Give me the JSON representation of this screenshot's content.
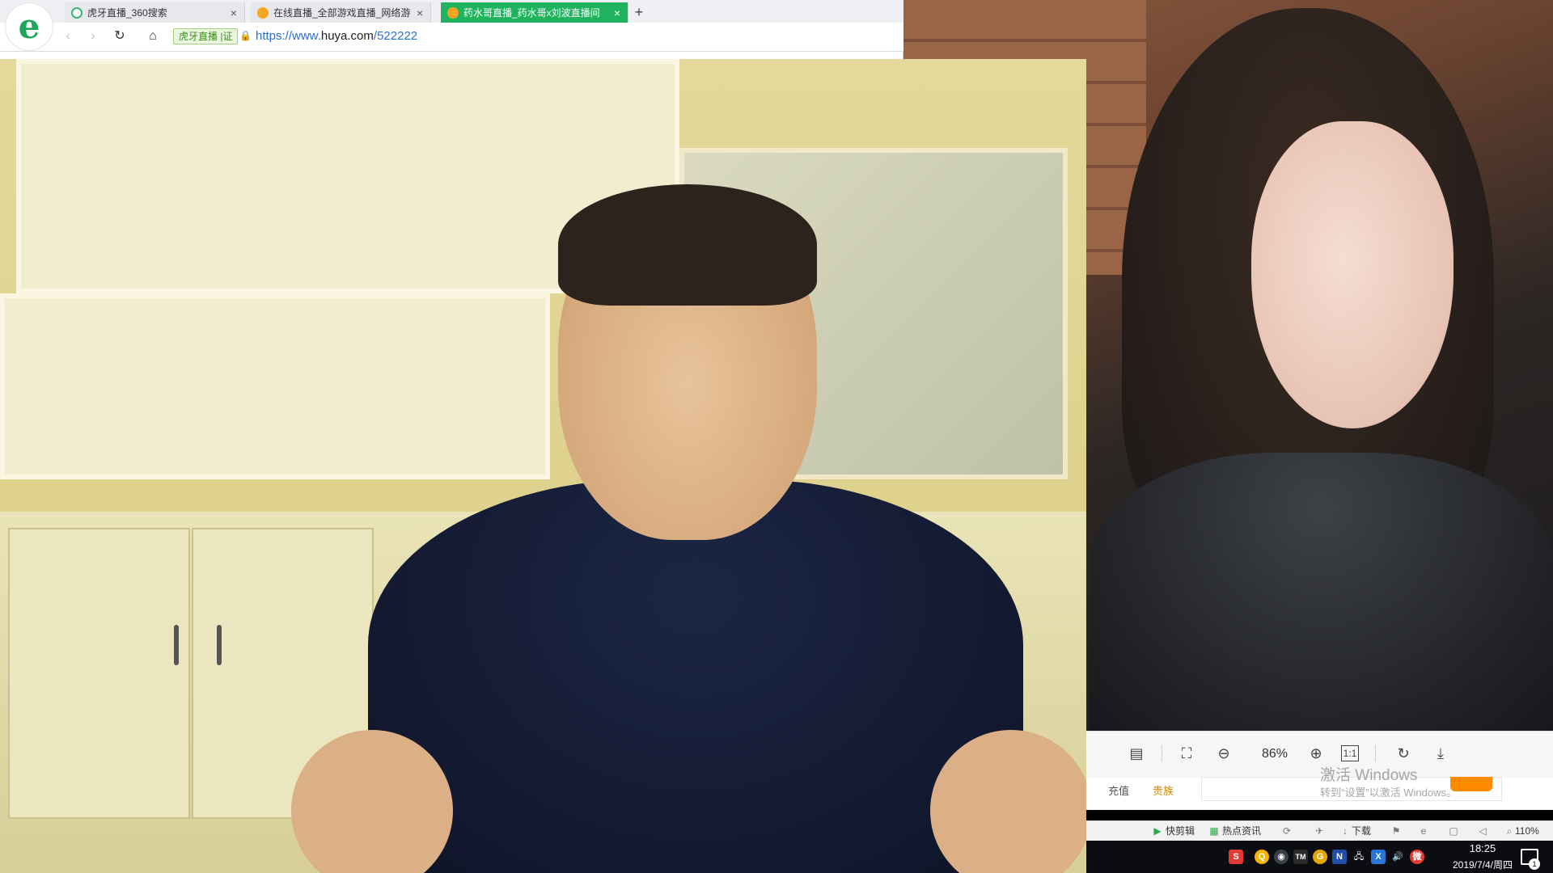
{
  "browser": {
    "tabs": [
      {
        "label": "虎牙直播_360搜索",
        "icon": "search-360-icon",
        "icon_color": "#3cb371",
        "active": false
      },
      {
        "label": "在线直播_全部游戏直播_网络游",
        "icon": "huya-icon",
        "icon_color": "#f5a623",
        "active": false
      },
      {
        "label": "药水哥直播_药水哥x刘波直播间",
        "icon": "huya-icon",
        "icon_color": "#f5a623",
        "active": true
      }
    ],
    "close_symbol": "×",
    "new_tab_symbol": "+",
    "logo_letter": "e",
    "back_symbol": "‹",
    "forward_symbol": "›",
    "reload_symbol": "↻",
    "home_symbol": "⌂",
    "site_badge": "虎牙直播 |证",
    "lock_symbol": "🔒",
    "url_scheme": "https://www.",
    "url_host": "huya.com",
    "url_path": "/522222"
  },
  "viewer": {
    "zoom_level": "86%",
    "tools": [
      {
        "name": "layout-icon",
        "symbol": "▤"
      },
      {
        "name": "fit-screen-icon",
        "symbol": "⛶"
      },
      {
        "name": "zoom-out-icon",
        "symbol": "⊖"
      },
      {
        "name": "zoom-in-icon",
        "symbol": "⊕"
      },
      {
        "name": "actual-size-icon",
        "symbol": "1:1"
      },
      {
        "name": "rotate-icon",
        "symbol": "↻"
      },
      {
        "name": "download-icon",
        "symbol": "⤓"
      }
    ]
  },
  "page_strip": {
    "recharge": "充值",
    "noble": "贵族"
  },
  "watermark": {
    "title": "激活 Windows",
    "subtitle": "转到“设置”以激活 Windows。"
  },
  "statusbar": {
    "items": [
      {
        "label": "快剪辑",
        "icon": "video-clip-icon"
      },
      {
        "label": "热点资讯",
        "icon": "news-icon"
      },
      {
        "label": "",
        "icon": "sync-icon"
      },
      {
        "label": "",
        "icon": "accelerate-icon"
      },
      {
        "label": "下载",
        "icon": "download-arrow-icon"
      },
      {
        "label": "",
        "icon": "translate-icon"
      },
      {
        "label": "",
        "icon": "ie-icon"
      },
      {
        "label": "",
        "icon": "window-icon"
      },
      {
        "label": "",
        "icon": "volume-icon"
      },
      {
        "label": "110%",
        "icon": "zoom-icon"
      }
    ]
  },
  "taskbar": {
    "tray": [
      {
        "name": "sogou-icon",
        "glyph": "S",
        "color": "#e53935"
      },
      {
        "name": "qq-icon",
        "glyph": "Q",
        "color": "#f5b400"
      },
      {
        "name": "steam-icon",
        "glyph": "◉",
        "color": "#3a3f4a"
      },
      {
        "name": "tm-icon",
        "glyph": "TM",
        "color": "#2a2a2a"
      },
      {
        "name": "chrome-icon",
        "glyph": "G",
        "color": "#e6a800"
      },
      {
        "name": "n-app-icon",
        "glyph": "N",
        "color": "#1f4fa8"
      },
      {
        "name": "network-icon",
        "glyph": "🖧",
        "color": "#0b0d12"
      },
      {
        "name": "x-app-icon",
        "glyph": "X",
        "color": "#2876d8"
      },
      {
        "name": "speaker-icon",
        "glyph": "🔊",
        "color": "#0b0d12"
      },
      {
        "name": "weibo-icon",
        "glyph": "微",
        "color": "#e53935"
      }
    ],
    "time": "18:25",
    "date": "2019/7/4/周四",
    "notification_count": "1"
  }
}
